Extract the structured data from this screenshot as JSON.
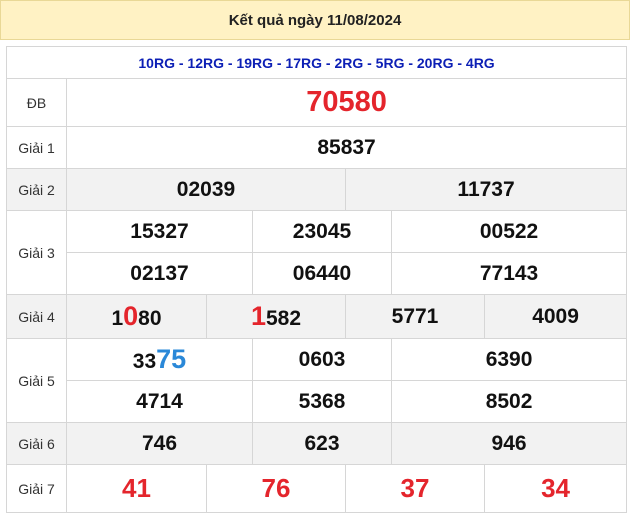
{
  "header": {
    "title": "Kết quả ngày 11/08/2024"
  },
  "codes": "10RG - 12RG - 19RG - 17RG - 2RG - 5RG - 20RG - 4RG",
  "labels": {
    "db": "ĐB",
    "g1": "Giải 1",
    "g2": "Giải 2",
    "g3": "Giải 3",
    "g4": "Giải 4",
    "g5": "Giải 5",
    "g6": "Giải 6",
    "g7": "Giải 7"
  },
  "prizes": {
    "db": "70580",
    "g1": "85837",
    "g2": [
      "02039",
      "11737"
    ],
    "g3": [
      "15327",
      "23045",
      "00522",
      "02137",
      "06440",
      "77143"
    ],
    "g4": [
      {
        "pre": "1",
        "hl": "0",
        "post": "80"
      },
      {
        "pre": "",
        "hl": "1",
        "post": "582"
      },
      {
        "pre": "5771",
        "hl": "",
        "post": ""
      },
      {
        "pre": "4009",
        "hl": "",
        "post": ""
      }
    ],
    "g5": [
      {
        "pre": "33",
        "hl": "75"
      },
      {
        "pre": "0603",
        "hl": ""
      },
      {
        "pre": "6390",
        "hl": ""
      },
      {
        "pre": "4714",
        "hl": ""
      },
      {
        "pre": "5368",
        "hl": ""
      },
      {
        "pre": "8502",
        "hl": ""
      }
    ],
    "g6": [
      "746",
      "623",
      "946"
    ],
    "g7": [
      "41",
      "76",
      "37",
      "34"
    ]
  },
  "colors": {
    "red": "#e4252c",
    "blue": "#2a88d8",
    "code_blue": "#0c1fb5",
    "header_bg": "#fff2c4",
    "stripe": "#f2f2f2"
  }
}
